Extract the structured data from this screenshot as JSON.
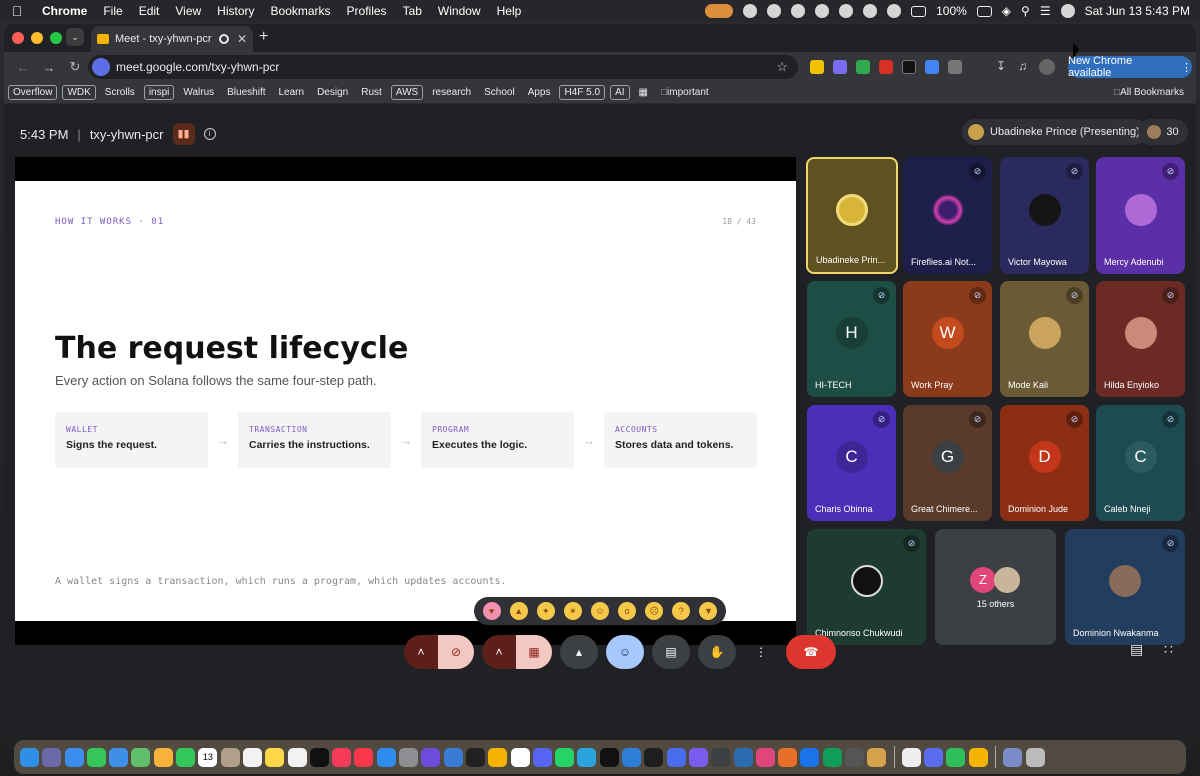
{
  "menubar": {
    "app": "Chrome",
    "items": [
      "File",
      "Edit",
      "View",
      "History",
      "Bookmarks",
      "Profiles",
      "Tab",
      "Window",
      "Help"
    ],
    "battery": "100%",
    "clock": "Sat Jun 13  5:43 PM"
  },
  "browser": {
    "tab_title": "Meet - txy-yhwn-pcr",
    "url": "meet.google.com/txy-yhwn-pcr",
    "new_chrome": "New Chrome available",
    "bookmarks": [
      "Overflow",
      "WDK",
      "Scrolls",
      "inspi",
      "Walrus",
      "Blueshift",
      "Learn",
      "Design",
      "Rust",
      "AWS",
      "research",
      "School",
      "Apps",
      "H4F 5.0",
      "AI"
    ],
    "bookmark_folder": "important",
    "all_bookmarks": "All Bookmarks"
  },
  "meet": {
    "time": "5:43 PM",
    "separator": "|",
    "code": "txy-yhwn-pcr",
    "presenter": "Ubadineke Prince (Presenting)",
    "participant_count": "30"
  },
  "slide": {
    "eyebrow": "HOW IT WORKS · 01",
    "page": "18 / 43",
    "title": "The request lifecycle",
    "subtitle": "Every action on Solana follows the same four-step path.",
    "steps": [
      {
        "key": "WALLET",
        "text": "Signs the request."
      },
      {
        "key": "TRANSACTION",
        "text": "Carries the instructions."
      },
      {
        "key": "PROGRAM",
        "text": "Executes the logic."
      },
      {
        "key": "ACCOUNTS",
        "text": "Stores data and tokens."
      }
    ],
    "footer": "A wallet signs a transaction, which runs a program, which updates accounts."
  },
  "participants": [
    {
      "name": "Ubadineke Prin...",
      "letter": "",
      "color": "#5e5320"
    },
    {
      "name": "Fireflies.ai Not...",
      "letter": "",
      "color": "#1d1f4a"
    },
    {
      "name": "Victor Mayowa",
      "letter": "",
      "color": "#2b2a5e"
    },
    {
      "name": "Mercy Adenubi",
      "letter": "",
      "color": "#5b2fa6"
    },
    {
      "name": "HI-TECH",
      "letter": "H",
      "color": "#1d4d45"
    },
    {
      "name": "Work Pray",
      "letter": "W",
      "color": "#8c3a1c"
    },
    {
      "name": "Mode Kali",
      "letter": "",
      "color": "#6b5a36"
    },
    {
      "name": "Hilda Enyioko",
      "letter": "",
      "color": "#6b2b24"
    },
    {
      "name": "Charis Obinna",
      "letter": "C",
      "color": "#4b2fb8"
    },
    {
      "name": "Great Chimere...",
      "letter": "G",
      "color": "#5a3a2a"
    },
    {
      "name": "Dominion Jude",
      "letter": "D",
      "color": "#8c2e14"
    },
    {
      "name": "Caleb Nneji",
      "letter": "C",
      "color": "#1e4b52"
    },
    {
      "name": "Chimnonso Chukwudi",
      "letter": "",
      "color": "#1d3b30"
    },
    {
      "name": "15 others",
      "letter": "Z",
      "color": "#3c4043"
    },
    {
      "name": "Dominion Nwakanma",
      "letter": "",
      "color": "#233d5e"
    }
  ]
}
